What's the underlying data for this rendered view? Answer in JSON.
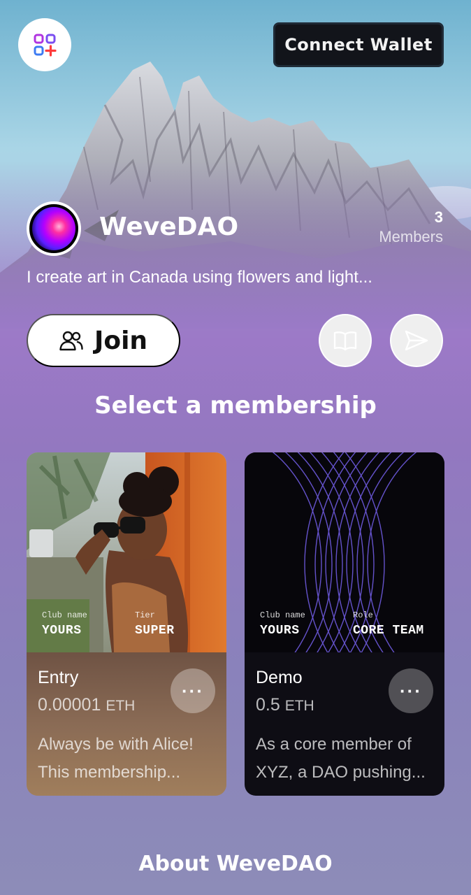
{
  "header": {
    "logo_icon": "app-grid-plus-icon",
    "connect_wallet_label": "Connect Wallet"
  },
  "dao": {
    "name": "WeveDAO",
    "members_count": "3",
    "members_label": "Members",
    "description": "I create art in Canada using flowers and light..."
  },
  "actions": {
    "join_label": "Join",
    "join_icon": "users-icon",
    "docs_icon": "book-icon",
    "share_icon": "send-icon"
  },
  "memberships": {
    "title": "Select a membership",
    "cards": [
      {
        "club_label": "Club name",
        "club_value": "YOURS",
        "meta_label": "Tier",
        "meta_value": "SUPER",
        "name": "Entry",
        "price": "0.00001",
        "unit": "ETH",
        "description": "Always be with Alice! This membership...",
        "more_label": "···"
      },
      {
        "club_label": "Club name",
        "club_value": "YOURS",
        "meta_label": "Role",
        "meta_value": "CORE TEAM",
        "name": "Demo",
        "price": "0.5",
        "unit": "ETH",
        "description": "As a core member of XYZ, a DAO pushing...",
        "more_label": "···"
      }
    ]
  },
  "about": {
    "title": "About WeveDAO"
  },
  "colors": {
    "accent_purple": "#9c79c7",
    "button_dark": "#12141a"
  }
}
